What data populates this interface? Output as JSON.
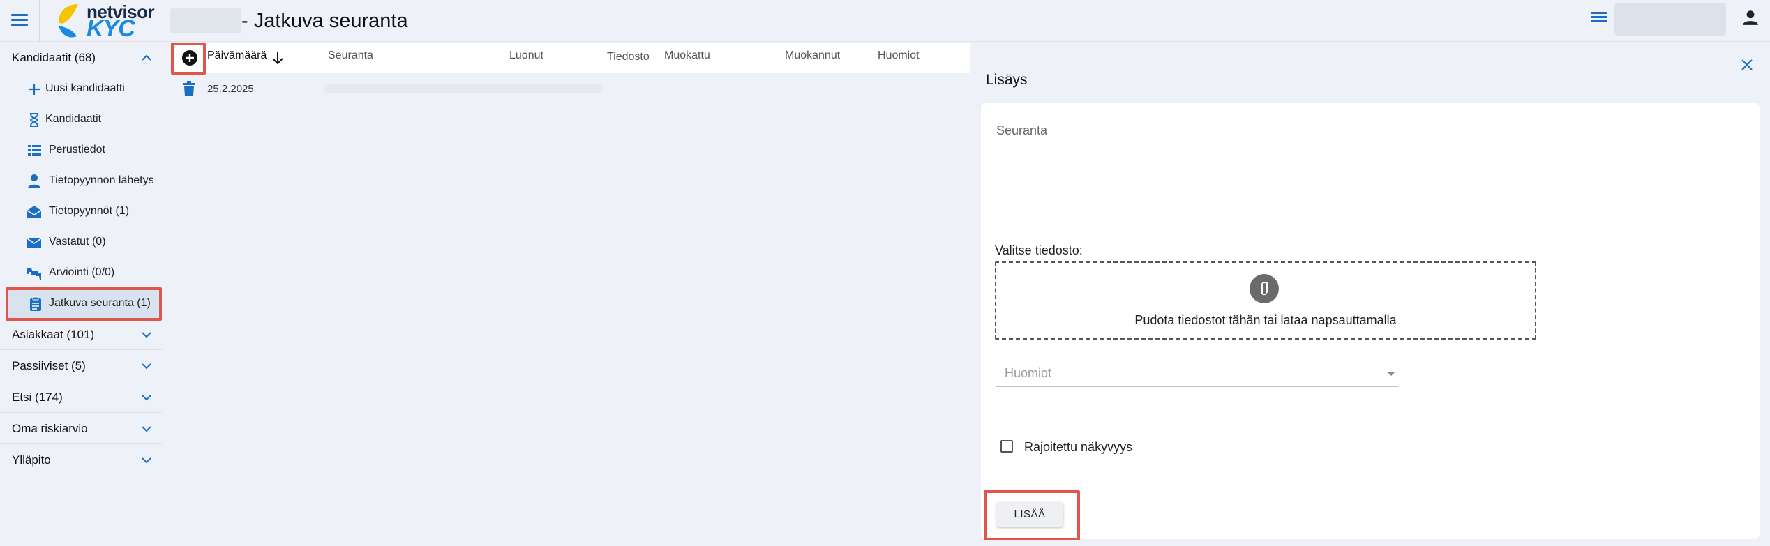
{
  "app": {
    "logo_name": "netvisor",
    "logo_product": "KYC",
    "page_title": "- Jatkuva seuranta",
    "colors": {
      "accent": "#1a6fc4",
      "highlight": "#e0574a",
      "logo_yellow": "#f5c400"
    }
  },
  "sidebar": {
    "sections": [
      {
        "label": "Kandidaatit (68)",
        "expanded": true
      },
      {
        "label": "Asiakkaat (101)",
        "expanded": false
      },
      {
        "label": "Passiiviset (5)",
        "expanded": false
      },
      {
        "label": "Etsi (174)",
        "expanded": false
      },
      {
        "label": "Oma riskiarvio",
        "expanded": false
      },
      {
        "label": "Ylläpito",
        "expanded": false
      }
    ],
    "items": [
      {
        "label": "Uusi kandidaatti",
        "icon": "plus-icon"
      },
      {
        "label": "Kandidaatit",
        "icon": "hourglass-icon"
      },
      {
        "label": "Perustiedot",
        "icon": "list-icon"
      },
      {
        "label": "Tietopyynnön lähetys",
        "icon": "person-icon"
      },
      {
        "label": "Tietopyynnöt (1)",
        "icon": "open-mail-icon"
      },
      {
        "label": "Vastatut (0)",
        "icon": "mail-icon"
      },
      {
        "label": "Arviointi (0/0)",
        "icon": "thumbs-icon"
      },
      {
        "label": "Jatkuva seuranta (1)",
        "icon": "clipboard-icon",
        "active": true
      }
    ]
  },
  "table": {
    "columns": [
      "Päivämäärä",
      "Seuranta",
      "Luonut",
      "Tiedosto",
      "Muokattu",
      "Muokannut",
      "Huomiot"
    ],
    "sort": "descending",
    "rows": [
      {
        "date": "25.2.2025"
      }
    ]
  },
  "panel": {
    "title": "Lisäys",
    "seuranta_label": "Seuranta",
    "file_label": "Valitse tiedosto:",
    "dropzone_text": "Pudota tiedostot tähän tai lataa napsauttamalla",
    "huomiot_placeholder": "Huomiot",
    "checkbox_label": "Rajoitettu näkyvyys",
    "checkbox_checked": false,
    "submit_label": "LISÄÄ"
  }
}
